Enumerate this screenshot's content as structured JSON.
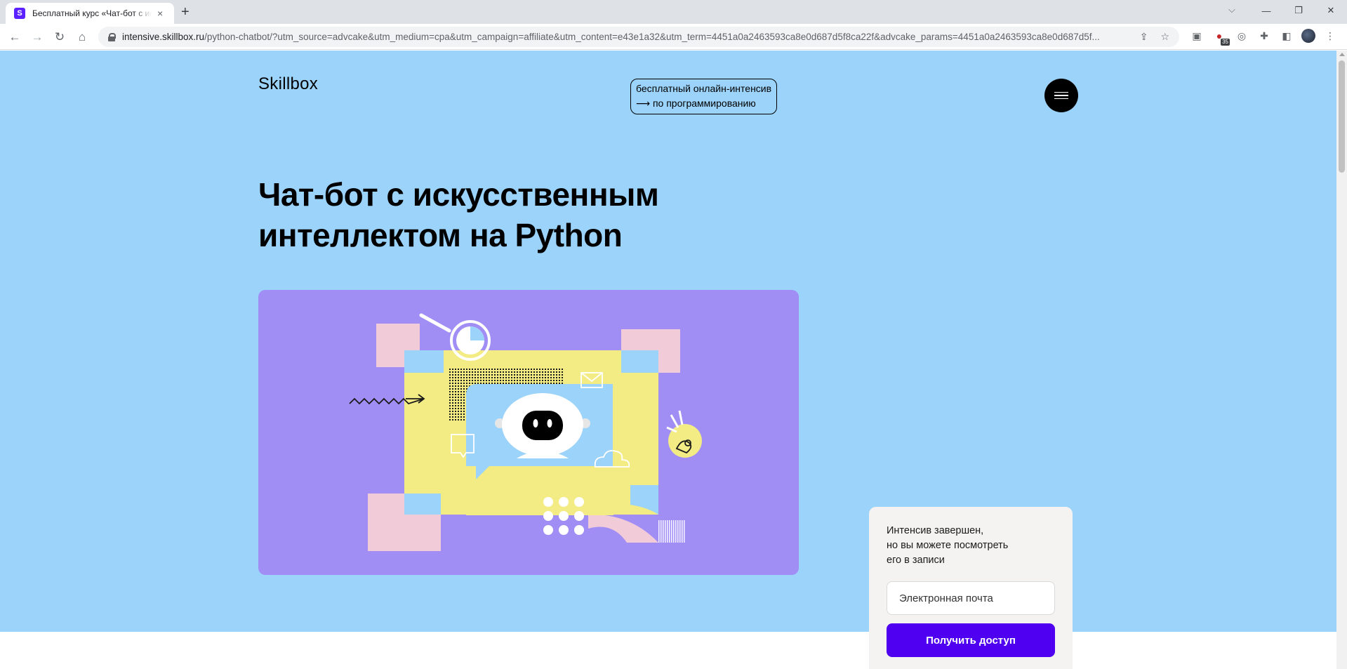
{
  "browser": {
    "tab_title": "Бесплатный курс «Чат-бот с искусственным интеллектом на Python»",
    "tab_favicon_letter": "S",
    "tab_close": "×",
    "new_tab": "+",
    "url_host": "intensive.skillbox.ru",
    "url_path": "/python-chatbot/?utm_source=advcake&utm_medium=cpa&utm_campaign=affiliate&utm_content=e43e1a32&utm_term=4451a0a2463593ca8e0d687d5f8ca22f&advcake_params=4451a0a2463593ca8e0d687d5f...",
    "extension_badge": "35"
  },
  "header": {
    "logo": "Skillbox",
    "tag_line1": "бесплатный онлайн-интенсив",
    "tag_line2": "⟶ по программированию"
  },
  "hero": {
    "title_line1": "Чат-бот с искусственным",
    "title_line2": "интеллектом на Python"
  },
  "signup": {
    "text_line1": "Интенсив завершен,",
    "text_line2": "но вы можете посмотреть",
    "text_line3": "его в записи",
    "email_placeholder": "Электронная почта",
    "submit_label": "Получить доступ"
  },
  "colors": {
    "hero_bg": "#9bd3fa",
    "illustration_bg": "#a18ef5",
    "accent": "#5000f0",
    "yellow": "#f3ec85",
    "pink": "#f2cbd8"
  }
}
